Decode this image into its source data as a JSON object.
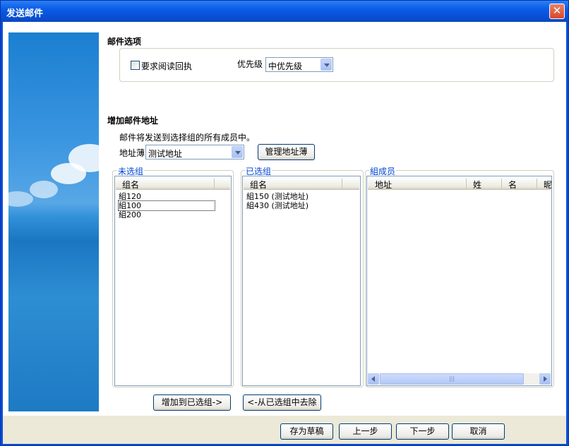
{
  "window": {
    "title": "发送邮件",
    "close_glyph": "✕"
  },
  "mail_options": {
    "section_title": "邮件选项",
    "read_receipt_label": "要求阅读回执",
    "read_receipt_checked": false,
    "priority_label": "优先级",
    "priority_value": "中优先级"
  },
  "add_address": {
    "section_title": "增加邮件地址",
    "description": "邮件将发送到选择组的所有成员中。",
    "address_book_label": "地址薄",
    "address_book_value": "测试地址",
    "manage_button": "管理地址薄"
  },
  "unselected_groups": {
    "legend": "未选组",
    "column": "组名",
    "items": [
      "組120",
      "組100",
      "組200"
    ]
  },
  "selected_groups": {
    "legend": "已选组",
    "column": "组名",
    "items": [
      "組150 (测试地址)",
      "組430 (测试地址)"
    ]
  },
  "group_members": {
    "legend": "組成员",
    "columns": [
      "地址",
      "姓",
      "名",
      "昵"
    ],
    "scroll_thumb_glyph": "|||"
  },
  "transfer": {
    "add_button": "增加到已选组->",
    "remove_button": "<-从已选组中去除"
  },
  "footer": {
    "save_draft": "存为草稿",
    "previous": "上一步",
    "next": "下一步",
    "cancel": "取消"
  }
}
